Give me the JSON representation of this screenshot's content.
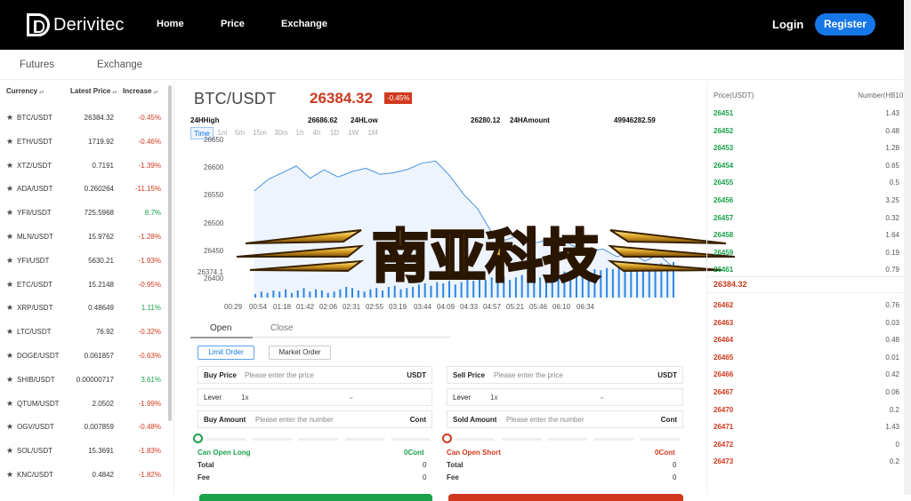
{
  "brand": {
    "name": "Derivitec"
  },
  "nav": {
    "home": "Home",
    "price": "Price",
    "exchange": "Exchange",
    "login": "Login",
    "register": "Register"
  },
  "subnav": {
    "futures": "Futures",
    "exchange": "Exchange"
  },
  "market_list": {
    "headers": {
      "currency": "Currency",
      "latest_price": "Latest Price",
      "increase": "Increase"
    },
    "rows": [
      {
        "name": "BTC/USDT",
        "price": "26384.32",
        "inc": "-0.45%",
        "up": false
      },
      {
        "name": "ETH/USDT",
        "price": "1719.92",
        "inc": "-0.46%",
        "up": false
      },
      {
        "name": "XTZ/USDT",
        "price": "0.7191",
        "inc": "-1.39%",
        "up": false
      },
      {
        "name": "ADA/USDT",
        "price": "0.260264",
        "inc": "-11.15%",
        "up": false
      },
      {
        "name": "YFII/USDT",
        "price": "725.5968",
        "inc": "8.7%",
        "up": true
      },
      {
        "name": "MLN/USDT",
        "price": "15.9762",
        "inc": "-1.28%",
        "up": false
      },
      {
        "name": "YFI/USDT",
        "price": "5630.21",
        "inc": "-1.93%",
        "up": false
      },
      {
        "name": "ETC/USDT",
        "price": "15.2148",
        "inc": "-0.95%",
        "up": false
      },
      {
        "name": "XRP/USDT",
        "price": "0.48649",
        "inc": "1.11%",
        "up": true
      },
      {
        "name": "LTC/USDT",
        "price": "76.92",
        "inc": "-0.32%",
        "up": false
      },
      {
        "name": "DOGE/USDT",
        "price": "0.061857",
        "inc": "-0.63%",
        "up": false
      },
      {
        "name": "SHIB/USDT",
        "price": "0.00000717",
        "inc": "3.61%",
        "up": true
      },
      {
        "name": "QTUM/USDT",
        "price": "2.0502",
        "inc": "-1.99%",
        "up": false
      },
      {
        "name": "OGV/USDT",
        "price": "0.007859",
        "inc": "-0.48%",
        "up": false
      },
      {
        "name": "SOL/USDT",
        "price": "15.3691",
        "inc": "-1.83%",
        "up": false
      },
      {
        "name": "KNC/USDT",
        "price": "0.4842",
        "inc": "-1.82%",
        "up": false
      }
    ]
  },
  "ticker": {
    "pair": "BTC/USDT",
    "price": "26384.32",
    "change": "-0.45%",
    "high_label": "24HHigh",
    "high": "26686.62",
    "low_label": "24HLow",
    "low": "26280.12",
    "amount_label": "24HAmount",
    "amount": "49946282.59"
  },
  "timeframes": [
    "Time",
    "1m",
    "5m",
    "15m",
    "30m",
    "1h",
    "4h",
    "1D",
    "1W",
    "1M"
  ],
  "chart_data": {
    "type": "line",
    "x": [
      "00:29",
      "00:54",
      "01:18",
      "01:42",
      "02:06",
      "02:31",
      "02:55",
      "03:19",
      "03:44",
      "04:09",
      "04:33",
      "04:57",
      "05:21",
      "05:46",
      "06:10",
      "06:34"
    ],
    "y_ticks": [
      26650,
      26600,
      26550,
      26500,
      26450,
      26400
    ],
    "ylim": [
      26374.1,
      26660
    ],
    "last_price_label": "26374.1",
    "series": [
      {
        "values": [
          26567,
          26588,
          26600,
          26612,
          26590,
          26605,
          26592,
          26602,
          26608,
          26597,
          26600,
          26606,
          26617,
          26621,
          26595,
          26561,
          26535,
          26493,
          26478,
          26487,
          26472,
          26478,
          26480,
          26466,
          26457,
          26462,
          26448,
          26456,
          26440,
          26452,
          26430
        ]
      }
    ],
    "volume": [
      3,
      5,
      4,
      6,
      5,
      7,
      4,
      6,
      8,
      5,
      7,
      6,
      4,
      5,
      7,
      9,
      8,
      6,
      5,
      7,
      8,
      6,
      9,
      10,
      7,
      8,
      9,
      11,
      12,
      10,
      13,
      12,
      14,
      11,
      13,
      15,
      14,
      16,
      15,
      17,
      16,
      18,
      15,
      17,
      19,
      18,
      20,
      17,
      19,
      21,
      20,
      22,
      21,
      19,
      23,
      22,
      24,
      23,
      25,
      24,
      26,
      25,
      27,
      26,
      28,
      27,
      26,
      29,
      28,
      30
    ],
    "line_color": "#4a90e2",
    "volume_color": "#2f86e3"
  },
  "banner": {
    "text": "南亚科技"
  },
  "order": {
    "tab_open": "Open",
    "tab_close": "Close",
    "limit": "Limit Order",
    "market": "Market Order",
    "buy_price_label": "Buy Price",
    "sell_price_label": "Sell Price",
    "price_placeholder": "Please enter the price",
    "unit_usdt": "USDT",
    "lever_label": "Lever",
    "lever_value": "1x",
    "buy_amount_label": "Buy Amount",
    "sell_amount_label": "Sold Amount",
    "amount_placeholder": "Please enter the number",
    "unit_cont": "Cont",
    "can_long": "Can Open Long",
    "can_short": "Can Open Short",
    "zero_cont": "0Cont",
    "total": "Total",
    "fee": "Fee",
    "zero": "0",
    "long_color": "#1aa14a",
    "short_color": "#d0391d"
  },
  "orderbook": {
    "price_header": "Price(USDT)",
    "number_header": "Number(HB10)",
    "asks": [
      {
        "p": "26451",
        "n": "1.43"
      },
      {
        "p": "26452",
        "n": "0.48"
      },
      {
        "p": "26453",
        "n": "1.28"
      },
      {
        "p": "26454",
        "n": "0.65"
      },
      {
        "p": "26455",
        "n": "0.5"
      },
      {
        "p": "26456",
        "n": "3.25"
      },
      {
        "p": "26457",
        "n": "0.32"
      },
      {
        "p": "26458",
        "n": "1.64"
      },
      {
        "p": "26459",
        "n": "0.19"
      },
      {
        "p": "26461",
        "n": "0.79"
      }
    ],
    "mid": "26384.32",
    "bids": [
      {
        "p": "26462",
        "n": "0.76"
      },
      {
        "p": "26463",
        "n": "0.03"
      },
      {
        "p": "26464",
        "n": "0.48"
      },
      {
        "p": "26465",
        "n": "0.01"
      },
      {
        "p": "26466",
        "n": "0.42"
      },
      {
        "p": "26467",
        "n": "0.06"
      },
      {
        "p": "26470",
        "n": "0.2"
      },
      {
        "p": "26471",
        "n": "1.43"
      },
      {
        "p": "26472",
        "n": "0"
      },
      {
        "p": "26473",
        "n": "0.2"
      }
    ]
  }
}
